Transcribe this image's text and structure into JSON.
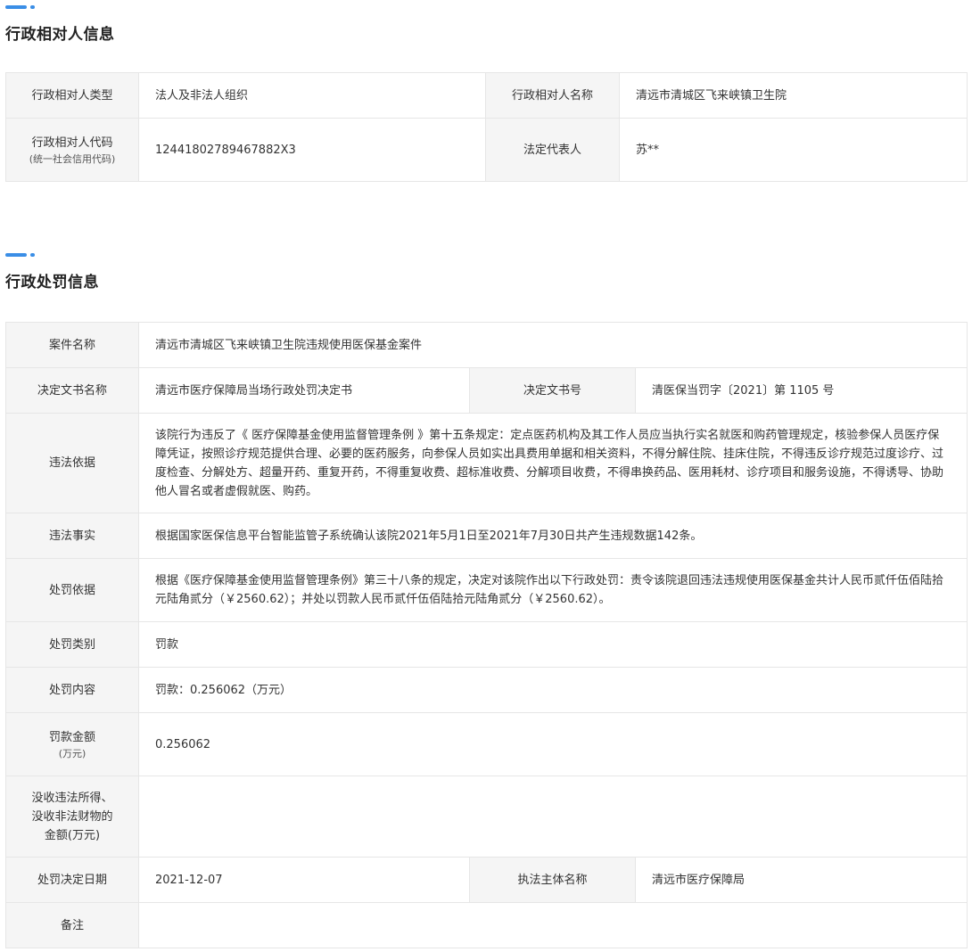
{
  "section1": {
    "title": "行政相对人信息",
    "type_label": "行政相对人类型",
    "type_value": "法人及非法人组织",
    "name_label": "行政相对人名称",
    "name_value": "清远市清城区飞来峡镇卫生院",
    "code_label": "行政相对人代码",
    "code_sublabel": "(统一社会信用代码)",
    "code_value": "12441802789467882X3",
    "rep_label": "法定代表人",
    "rep_value": "苏**"
  },
  "section2": {
    "title": "行政处罚信息",
    "case_name_label": "案件名称",
    "case_name_value": "清远市清城区飞来峡镇卫生院违规使用医保基金案件",
    "doc_name_label": "决定文书名称",
    "doc_name_value": "清远市医疗保障局当场行政处罚决定书",
    "doc_no_label": "决定文书号",
    "doc_no_value": "清医保当罚字〔2021〕第 1105 号",
    "basis_label": "违法依据",
    "basis_value": "该院行为违反了《 医疗保障基金使用监督管理条例 》第十五条规定：定点医药机构及其工作人员应当执行实名就医和购药管理规定，核验参保人员医疗保障凭证，按照诊疗规范提供合理、必要的医药服务，向参保人员如实出具费用单据和相关资料，不得分解住院、挂床住院，不得违反诊疗规范过度诊疗、过度检查、分解处方、超量开药、重复开药，不得重复收费、超标准收费、分解项目收费，不得串换药品、医用耗材、诊疗项目和服务设施，不得诱导、协助他人冒名或者虚假就医、购药。",
    "facts_label": "违法事实",
    "facts_value": "根据国家医保信息平台智能监管子系统确认该院2021年5月1日至2021年7月30日共产生违规数据142条。",
    "penalty_basis_label": "处罚依据",
    "penalty_basis_value": "根据《医疗保障基金使用监督管理条例》第三十八条的规定，决定对该院作出以下行政处罚：责令该院退回违法违规使用医保基金共计人民币贰仟伍佰陆拾元陆角贰分（￥2560.62）；并处以罚款人民币贰仟伍佰陆拾元陆角贰分（￥2560.62）。",
    "category_label": "处罚类别",
    "category_value": "罚款",
    "content_label": "处罚内容",
    "content_value": "罚款：0.256062（万元）",
    "amount_label": "罚款金额",
    "amount_sublabel": "(万元)",
    "amount_value": "0.256062",
    "confiscate_label_1": "没收违法所得、",
    "confiscate_label_2": "没收非法财物的",
    "confiscate_label_3": "金额(万元)",
    "confiscate_value": "",
    "date_label": "处罚决定日期",
    "date_value": "2021-12-07",
    "authority_label": "执法主体名称",
    "authority_value": "清远市医疗保障局",
    "remark_label": "备注",
    "remark_value": ""
  }
}
